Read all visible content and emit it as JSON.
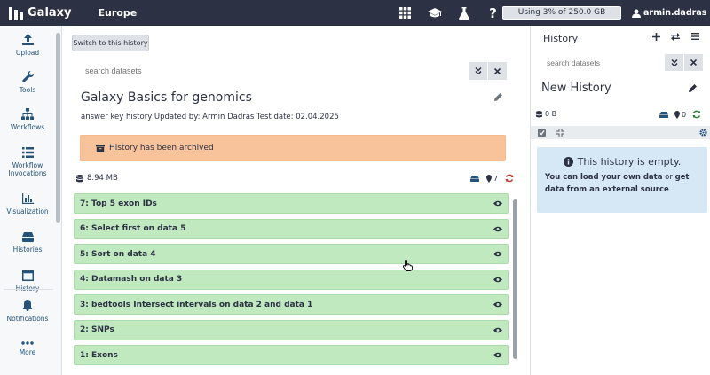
{
  "brand": {
    "name": "Galaxy",
    "instance": "Europe"
  },
  "masthead": {
    "icons": [
      "grid-icon",
      "graduation-cap-icon",
      "flask-icon",
      "help-icon"
    ],
    "help_label": "?",
    "quota": "Using 3% of 250.0 GB",
    "username": "armin.dadras"
  },
  "sidebar": {
    "items": [
      {
        "label": "Upload",
        "icon": "upload-icon"
      },
      {
        "label": "Tools",
        "icon": "wrench-icon"
      },
      {
        "label": "Workflows",
        "icon": "sitemap-icon"
      },
      {
        "label": "Workflow Invocations",
        "icon": "list-icon"
      },
      {
        "label": "Visualization",
        "icon": "chart-icon"
      },
      {
        "label": "Histories",
        "icon": "database-icon"
      },
      {
        "label": "History",
        "icon": "columns-icon"
      },
      {
        "label": "Notifications",
        "icon": "bell-icon"
      },
      {
        "label": "More",
        "icon": "ellipsis-icon"
      }
    ]
  },
  "center": {
    "switch_label": "Switch to this history",
    "search_placeholder": "search datasets",
    "history_name": "Galaxy Basics for genomics",
    "annotation": "answer key history Updated by: Armin Dadras Test date: 02.04.2025",
    "archived_notice": "History has been archived",
    "size": "8.94 MB",
    "status_counts": {
      "deleted": "",
      "hidden": "7"
    },
    "datasets": [
      {
        "hid": "7",
        "name": "Top 5 exon IDs"
      },
      {
        "hid": "6",
        "name": "Select first on data 5"
      },
      {
        "hid": "5",
        "name": "Sort on data 4"
      },
      {
        "hid": "4",
        "name": "Datamash on data 3"
      },
      {
        "hid": "3",
        "name": "bedtools Intersect intervals on data 2 and data 1"
      },
      {
        "hid": "2",
        "name": "SNPs"
      },
      {
        "hid": "1",
        "name": "Exons"
      }
    ]
  },
  "history_panel": {
    "title": "History",
    "search_placeholder": "search datasets",
    "name": "New History",
    "size": "0 B",
    "status_counts": {
      "deleted": "",
      "hidden": "0"
    },
    "empty_title": "This history is empty.",
    "empty_line1_a": "You can load your own data",
    "empty_line1_b": " or ",
    "empty_line1_c": "get",
    "empty_line2_a": "data from an external source",
    "empty_line2_b": "."
  },
  "colors": {
    "masthead": "#2c3143",
    "dataset_ok": "#c0e9bf",
    "archived": "#f8c39a",
    "empty_info": "#d6e8f5",
    "link": "#25537b"
  }
}
